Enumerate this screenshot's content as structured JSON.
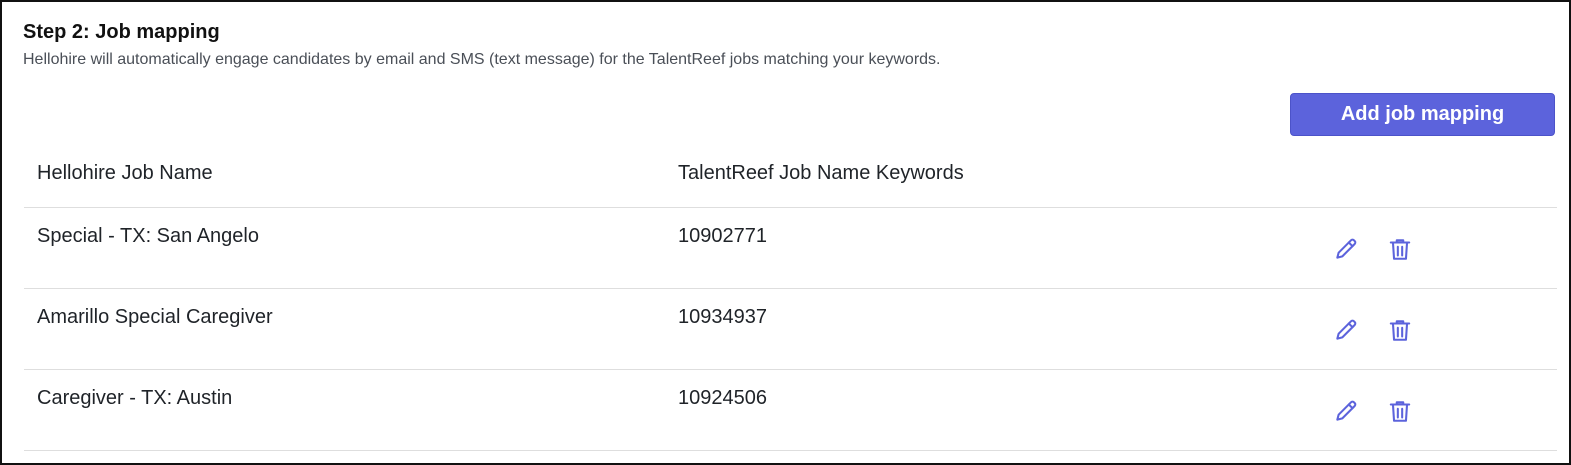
{
  "section": {
    "title": "Step 2: Job mapping",
    "description": "Hellohire will automatically engage candidates by email and SMS (text message) for the TalentReef jobs matching your keywords."
  },
  "toolbar": {
    "add_label": "Add job mapping"
  },
  "table": {
    "columns": [
      "Hellohire Job Name",
      "TalentReef Job Name Keywords"
    ],
    "rows": [
      {
        "job_name": "Special - TX: San Angelo",
        "keywords": "10902771"
      },
      {
        "job_name": "Amarillo Special Caregiver",
        "keywords": "10934937"
      },
      {
        "job_name": "Caregiver - TX: Austin",
        "keywords": "10924506"
      }
    ]
  },
  "icons": {
    "edit": "pencil-icon",
    "delete": "trash-icon"
  },
  "colors": {
    "accent": "#5c63dc",
    "divider": "#dedede"
  }
}
